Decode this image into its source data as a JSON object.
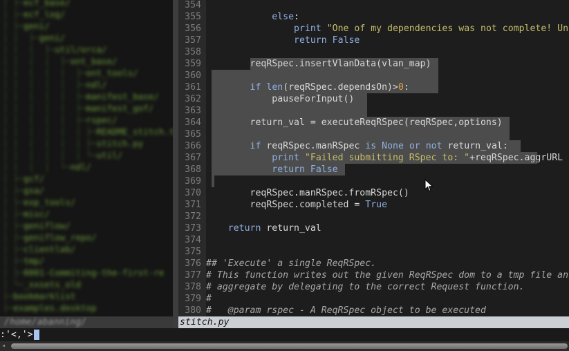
{
  "tree": {
    "rows": [
      {
        "indent": "│ ├─",
        "text": "ecf_base/"
      },
      {
        "indent": "│ ├─",
        "text": "ecf_log/"
      },
      {
        "indent": "│ ├─",
        "text": "geni/"
      },
      {
        "indent": "│ │  ├─",
        "text": "geni/"
      },
      {
        "indent": "│ │  │  ├─",
        "text": "util/orca/"
      },
      {
        "indent": "│ │  │  │  ├─",
        "text": "ont_base/"
      },
      {
        "indent": "│ │  │  │  │  ├─",
        "text": "ont_tools/"
      },
      {
        "indent": "│ │  │  │  │  ├─",
        "text": "ndl/"
      },
      {
        "indent": "│ │  │  │  │  ├─",
        "text": "manifest_base/"
      },
      {
        "indent": "│ │  │  │  │  ├─",
        "text": "manifest_gof/"
      },
      {
        "indent": "│ │  │  │  │  ├─",
        "text": "rspec/"
      },
      {
        "indent": "│ │  │  │  │  │ ├─",
        "text": "README_stitch.txt"
      },
      {
        "indent": "│ │  │  │  │  │ ├─",
        "text": "stitch.py"
      },
      {
        "indent": "│ │  │  │  │  │ └─",
        "text": "util/"
      },
      {
        "indent": "│ │  │  │  └─",
        "text": "ndl/"
      },
      {
        "indent": "│ ├─",
        "text": "gcf/"
      },
      {
        "indent": "│ ├─",
        "text": "gsa/"
      },
      {
        "indent": "│ ├─",
        "text": "exp_tools/"
      },
      {
        "indent": "│ ├─",
        "text": "misc/"
      },
      {
        "indent": "│ ├─",
        "text": "geniflow/"
      },
      {
        "indent": "│ ├─",
        "text": "geniflow_repo/"
      },
      {
        "indent": "│ ├─",
        "text": "clientlab/"
      },
      {
        "indent": "│ ├─",
        "text": "tmp/"
      },
      {
        "indent": "│ ├─",
        "text": "0001-Commiting-the-first-re"
      },
      {
        "indent": "│ └─",
        "text": "_xxsets_old"
      },
      {
        "indent": "├─",
        "text": "bookmarklist"
      },
      {
        "indent": "├─",
        "text": "examples.desktop"
      }
    ],
    "current_path": "/home/abanning/"
  },
  "editor": {
    "lines": [
      {
        "n": "354",
        "code": ""
      },
      {
        "n": "355",
        "code": "            else:"
      },
      {
        "n": "356",
        "code": "                print \"One of my dependencies was not complete! Un"
      },
      {
        "n": "357",
        "code": "                return False"
      },
      {
        "n": "358",
        "code": ""
      },
      {
        "n": "359",
        "code": "        reqRSpec.insertVlanData(vlan_map)"
      },
      {
        "n": "360",
        "code": ""
      },
      {
        "n": "361",
        "code": "        if len(reqRSpec.dependsOn)>0:"
      },
      {
        "n": "362",
        "code": "            pauseForInput()"
      },
      {
        "n": "363",
        "code": ""
      },
      {
        "n": "364",
        "code": "        return_val = executeReqRSpec(reqRSpec,options)"
      },
      {
        "n": "365",
        "code": ""
      },
      {
        "n": "366",
        "code": "        if reqRSpec.manRSpec is None or not return_val:"
      },
      {
        "n": "367",
        "code": "            print \"Failed submitting RSpec to: \"+reqRSpec.aggrURL"
      },
      {
        "n": "368",
        "code": "            return False"
      },
      {
        "n": "369",
        "code": ""
      },
      {
        "n": "370",
        "code": "        reqRSpec.manRSpec.fromRSpec()"
      },
      {
        "n": "371",
        "code": "        reqRSpec.completed = True"
      },
      {
        "n": "372",
        "code": ""
      },
      {
        "n": "373",
        "code": "    return return_val"
      },
      {
        "n": "374",
        "code": ""
      },
      {
        "n": "375",
        "code": ""
      },
      {
        "n": "376",
        "code": "## 'Execute' a single ReqRSpec."
      },
      {
        "n": "377",
        "code": "# This function writes out the given ReqRSpec dom to a tmp file an"
      },
      {
        "n": "378",
        "code": "# aggregate by delegating to the correct Request function."
      },
      {
        "n": "379",
        "code": "#"
      },
      {
        "n": "380",
        "code": "#   @param rspec - A ReqRSpec object to be executed"
      }
    ]
  },
  "statusline": {
    "filename": "stitch.py"
  },
  "cmdline": {
    "text": ":'<,'>"
  },
  "colors": {
    "background": "#1d1d1d",
    "gutter": "#2a2a2a",
    "visual_selection": "#4c4c4c",
    "keyword": "#8fb0e0",
    "string": "#c5bd6a",
    "number": "#e0a040",
    "statusline": "#ccd0d4"
  }
}
